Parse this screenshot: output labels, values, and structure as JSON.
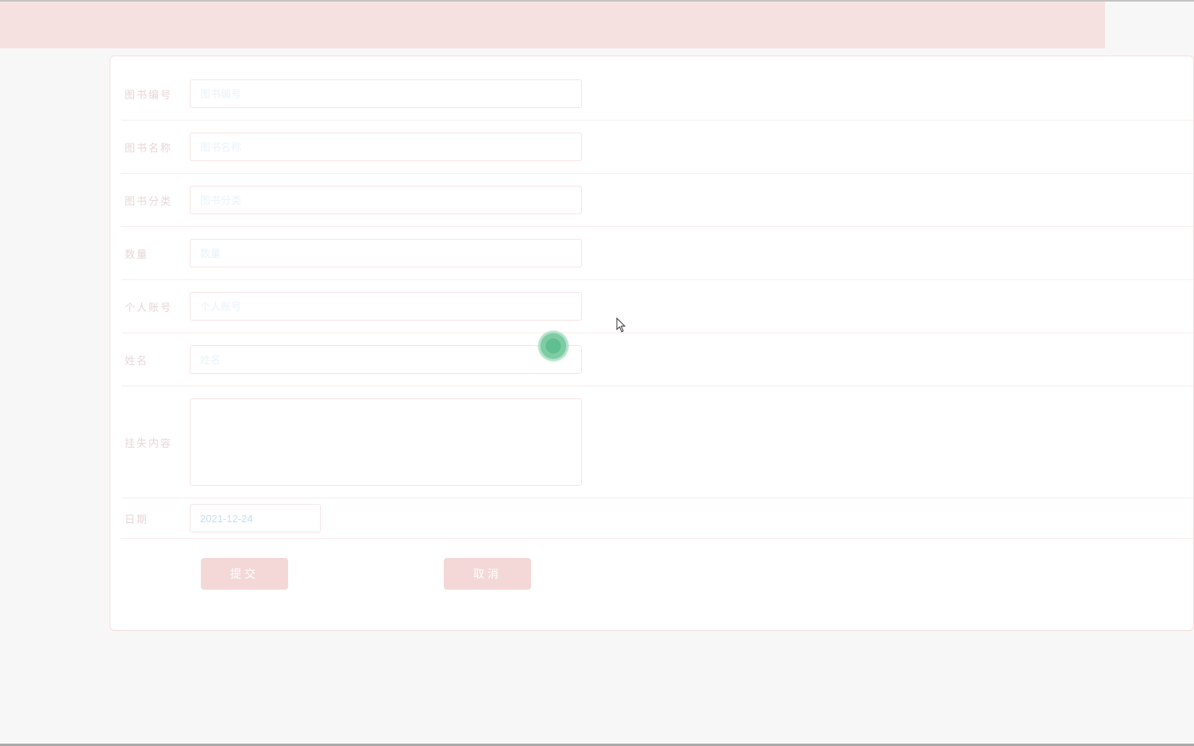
{
  "form": {
    "book_id": {
      "label": "图书编号",
      "placeholder": "图书编号",
      "value": ""
    },
    "book_name": {
      "label": "图书名称",
      "placeholder": "图书名称",
      "value": ""
    },
    "book_cat": {
      "label": "图书分类",
      "placeholder": "图书分类",
      "value": ""
    },
    "quantity": {
      "label": "数量",
      "placeholder": "数量",
      "value": ""
    },
    "account": {
      "label": "个人账号",
      "placeholder": "个人账号",
      "value": ""
    },
    "name": {
      "label": "姓名",
      "placeholder": "姓名",
      "value": ""
    },
    "lost": {
      "label": "挂失内容",
      "placeholder": "",
      "value": ""
    },
    "date": {
      "label": "日期",
      "placeholder": "",
      "value": "2021-12-24"
    }
  },
  "buttons": {
    "submit": "提交",
    "cancel": "取消"
  }
}
